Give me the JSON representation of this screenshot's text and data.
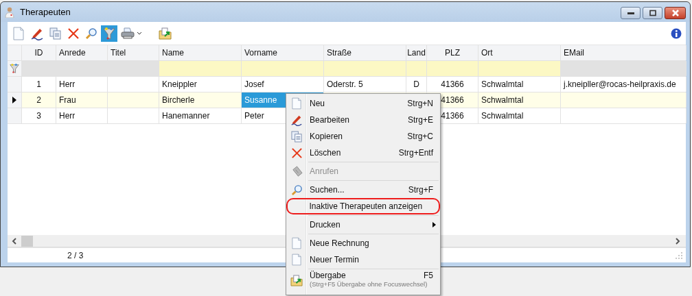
{
  "window": {
    "title": "Therapeuten"
  },
  "toolbar": [
    {
      "kind": "new",
      "selected": false
    },
    {
      "kind": "edit",
      "selected": false
    },
    {
      "kind": "copy",
      "selected": false
    },
    {
      "kind": "delete",
      "selected": false
    },
    {
      "kind": "search",
      "selected": false
    },
    {
      "kind": "filter",
      "selected": true
    },
    {
      "kind": "print",
      "selected": false
    },
    {
      "kind": "transfer",
      "selected": false
    }
  ],
  "table": {
    "columns": [
      {
        "label": "ID",
        "kind": "numeric",
        "filterable": false
      },
      {
        "label": "Anrede",
        "kind": "text",
        "filterable": false
      },
      {
        "label": "Titel",
        "kind": "text",
        "filterable": false
      },
      {
        "label": "Name",
        "kind": "text",
        "filterable": true
      },
      {
        "label": "Vorname",
        "kind": "text",
        "filterable": true
      },
      {
        "label": "Straße",
        "kind": "text",
        "filterable": true
      },
      {
        "label": "Land",
        "kind": "numeric",
        "filterable": true
      },
      {
        "label": "PLZ",
        "kind": "numeric",
        "filterable": true
      },
      {
        "label": "Ort",
        "kind": "text",
        "filterable": true
      },
      {
        "label": "EMail",
        "kind": "text",
        "filterable": false
      }
    ],
    "rows": [
      {
        "selected": false,
        "cells": [
          {
            "text": "1",
            "focused": false
          },
          {
            "text": "Herr",
            "focused": false
          },
          {
            "focused": false
          },
          {
            "text": "Kneippler",
            "focused": false
          },
          {
            "text": "Josef",
            "focused": false
          },
          {
            "text": "Oderstr. 5",
            "focused": false
          },
          {
            "text": "D",
            "focused": false
          },
          {
            "text": "41366",
            "focused": false
          },
          {
            "text": "Schwalmtal",
            "focused": false
          },
          {
            "text": "j.kneipller@rocas-heilpraxis.de",
            "focused": false
          }
        ]
      },
      {
        "selected": true,
        "cells": [
          {
            "text": "2",
            "focused": false
          },
          {
            "text": "Frau",
            "focused": false
          },
          {
            "focused": false
          },
          {
            "text": "Bircherle",
            "focused": false
          },
          {
            "text": "Susanne",
            "focused": true
          },
          null,
          null,
          {
            "text": "41366",
            "focused": false
          },
          {
            "text": "Schwalmtal",
            "focused": false
          },
          {
            "focused": false
          }
        ]
      },
      {
        "selected": false,
        "cells": [
          {
            "text": "3",
            "focused": false
          },
          {
            "text": "Herr",
            "focused": false
          },
          {
            "focused": false
          },
          {
            "text": "Hanemanner",
            "focused": false
          },
          {
            "text": "Peter",
            "focused": false
          },
          null,
          null,
          {
            "text": "41366",
            "focused": false
          },
          {
            "text": "Schwalmtal",
            "focused": false
          },
          {
            "focused": false
          }
        ]
      }
    ]
  },
  "status_bar": {
    "record": "2 / 3"
  },
  "context_menu": [
    {
      "kind": "new",
      "label": "Neu",
      "shortcut": "Strg+N",
      "disabled": false,
      "highlighted": false
    },
    {
      "kind": "edit",
      "label": "Bearbeiten",
      "shortcut": "Strg+E",
      "disabled": false,
      "highlighted": false
    },
    {
      "kind": "copy",
      "label": "Kopieren",
      "shortcut": "Strg+C",
      "disabled": false,
      "highlighted": false
    },
    {
      "kind": "delete",
      "label": "Löschen",
      "shortcut": "Strg+Entf",
      "disabled": false,
      "highlighted": false
    },
    {
      "kind": "separator"
    },
    {
      "kind": "phone",
      "label": "Anrufen",
      "disabled": true,
      "highlighted": false
    },
    {
      "kind": "separator"
    },
    {
      "kind": "search",
      "label": "Suchen...",
      "shortcut": "Strg+F",
      "disabled": false,
      "highlighted": false
    },
    {
      "kind": "plain",
      "label": "Inaktive Therapeuten anzeigen",
      "disabled": false,
      "highlighted": true
    },
    {
      "kind": "separator"
    },
    {
      "kind": "submenu",
      "label": "Drucken",
      "disabled": false,
      "highlighted": false
    },
    {
      "kind": "separator"
    },
    {
      "kind": "new",
      "label": "Neue Rechnung",
      "disabled": false,
      "highlighted": false
    },
    {
      "kind": "new",
      "label": "Neuer Termin",
      "disabled": false,
      "highlighted": false
    },
    {
      "kind": "separator"
    },
    {
      "kind": "transfer",
      "label": "Übergabe",
      "note": "(Strg+F5 Übergabe ohne Focuswechsel)",
      "shortcut": "F5",
      "disabled": false,
      "highlighted": false
    }
  ]
}
